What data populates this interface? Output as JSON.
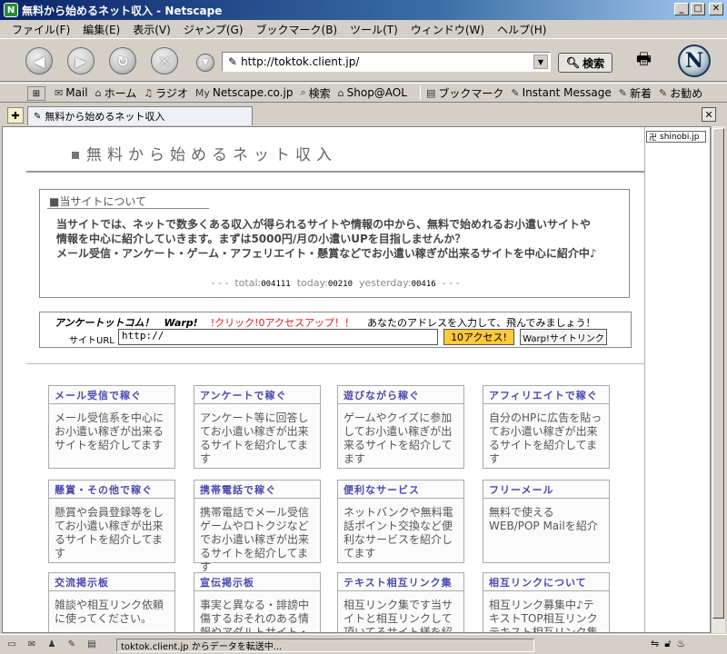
{
  "window": {
    "title": "無料から始めるネット収入 - Netscape"
  },
  "menu": [
    "ファイル(F)",
    "編集(E)",
    "表示(V)",
    "ジャンプ(G)",
    "ブックマーク(B)",
    "ツール(T)",
    "ウィンドウ(W)",
    "ヘルプ(H)"
  ],
  "nav": {
    "url": "http://toktok.client.jp/",
    "search_label": "検索",
    "logo_letter": "N"
  },
  "personal_toolbar": [
    {
      "label": "Mail",
      "icon": "mail-icon"
    },
    {
      "label": "ホーム",
      "icon": "home-icon"
    },
    {
      "label": "ラジオ",
      "icon": "radio-icon"
    },
    {
      "label": "Netscape.co.jp",
      "icon": "my-icon"
    },
    {
      "label": "検索",
      "icon": "search-icon"
    },
    {
      "label": "Shop@AOL",
      "icon": "shop-icon"
    },
    {
      "label": "ブックマーク",
      "icon": "bookmark-icon"
    },
    {
      "label": "Instant Message",
      "icon": "im-icon"
    },
    {
      "label": "新着",
      "icon": "new-icon"
    },
    {
      "label": "お勧め",
      "icon": "recommend-icon"
    }
  ],
  "tab": {
    "label": "無料から始めるネット収入"
  },
  "page": {
    "title": "無料から始めるネット収入",
    "about_heading": "■当サイトについて",
    "about_text_1": "当サイトでは、ネットで数多くある収入が得られるサイトや情報の中から、無料で始めれるお小遣いサイトや",
    "about_text_2": "情報を中心に紹介していきます。まずは5000円/月の小遣いUPを目指しませんか？",
    "about_text_3": "メール受信・アンケート・ゲーム・アフェリエイト・懸賞などでお小遣い稼ぎが出来るサイトを中心に紹介中♪",
    "counter": {
      "dashes": "- - -",
      "total_label": "total:",
      "total": "004111",
      "today_label": "today:",
      "today": "00210",
      "yesterday_label": "yesterday:",
      "yesterday": "00416"
    },
    "warp": {
      "logo": "アンケートットコム！　Warp!",
      "click_text": "!クリック!0アクセスアップ！！",
      "prompt": "あなたのアドレスを入力して、飛んでみましょう！",
      "url_label": "サイトURL",
      "input_value": "http://",
      "go_button": "10アクセス!",
      "link_button": "Warp!サイトリンク"
    },
    "categories": [
      {
        "title": "メール受信で稼ぐ",
        "desc": "メール受信系を中心にお小遣い稼ぎが出来るサイトを紹介してます"
      },
      {
        "title": "アンケートで稼ぐ",
        "desc": "アンケート等に回答してお小遣い稼ぎが出来るサイトを紹介してます"
      },
      {
        "title": "遊びながら稼ぐ",
        "desc": "ゲームやクイズに参加してお小遣い稼ぎが出来るサイトを紹介してます"
      },
      {
        "title": "アフィリエイトで稼ぐ",
        "desc": "自分のHPに広告を貼ってお小遣い稼ぎが出来るサイトを紹介してます"
      },
      {
        "title": "懸賞・その他で稼ぐ",
        "desc": "懸賞や会員登録等をしてお小遣い稼ぎが出来るサイトを紹介してます"
      },
      {
        "title": "携帯電話で稼ぐ",
        "desc": "携帯電話でメール受信ゲームやロトクジなどでお小遣い稼ぎが出来るサイトを紹介してます"
      },
      {
        "title": "便利なサービス",
        "desc": "ネットバンクや無料電話ポイント交換など便利なサービスを紹介してます"
      },
      {
        "title": "フリーメール",
        "desc": "無料で使えるWEB/POP Mailを紹介"
      },
      {
        "title": "交流掲示板",
        "desc": "雑談や相互リンク依頼に使ってください。"
      },
      {
        "title": "宣伝掲示板",
        "desc": "事実と異なる・誹謗中傷するおそれのある情報やアダルトサイト・宗教関係"
      },
      {
        "title": "テキスト相互リンク集",
        "desc": "相互リンク集です当サイトと相互リンクして頂いてるサイト様を紹介"
      },
      {
        "title": "相互リンクについて",
        "desc": "相互リンク募集中♪テキストTOP相互リンクテキスト相互リンク集"
      }
    ],
    "sidebar_badge": "shinobi.jp"
  },
  "status": {
    "text": "toktok.client.jp からデータを転送中..."
  }
}
